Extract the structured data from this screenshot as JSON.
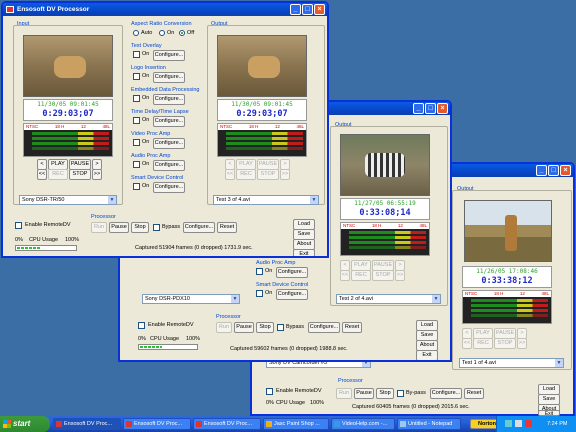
{
  "window1": {
    "title": "Ensosoft DV Processor",
    "input_label": "Input",
    "output_label": "Output",
    "in_date": "11/30/05 09:01:45",
    "in_time": "0:29:03;07",
    "out_date": "11/30/05 09:01:45",
    "out_time": "0:29:03;07",
    "meter_labels": [
      "NTSC",
      "18 H",
      "12",
      "48L"
    ],
    "aspect_label": "Aspect Ratio Conversion",
    "aspect_options": [
      "Auto",
      "On",
      "Off"
    ],
    "text_overlay": "Text Overlay",
    "logo_insertion": "Logo Insertion",
    "embedded": "Embedded Data Processing",
    "time_delay": "Time Delay/Time Lapse",
    "video_proc": "Video Proc Amp",
    "audio_proc": "Audio Proc Amp",
    "smart_device": "Smart Device Control",
    "on": "On",
    "configure": "Configure...",
    "play": "PLAY",
    "pause": "PAUSE",
    "rec": "REC",
    "stop": "STOP",
    "rew": "<<",
    "ffw": ">>",
    "prev": "<",
    "next": ">",
    "input_device": "Sony DSR-TR/50",
    "output_file": "Test 3 of 4.avi",
    "enable_remote": "Enable RemoteDV",
    "processor": "Processor",
    "run": "Run",
    "pause_btn": "Pause",
    "stop_btn": "Stop",
    "bypass": "Bypass",
    "reset": "Reset",
    "cpu_min": "0%",
    "cpu_label": "CPU Usage",
    "cpu_max": "100%",
    "captured": "Captured 51904 frames (0 dropped) 1731.9 sec.",
    "load": "Load",
    "save": "Save",
    "about": "About",
    "exit": "Exit"
  },
  "window2": {
    "output_label": "Output",
    "out_date": "11/27/05 06:55:19",
    "out_time": "0:33:08;14",
    "input_device": "Sony DSR-PDX10",
    "output_file": "Test 2 of 4.avi",
    "audio_proc": "Audio Proc Amp",
    "smart_device": "Smart Device Control",
    "captured": "Captured 59602 frames (0 dropped) 1988.8 sec."
  },
  "window3": {
    "output_label": "Output",
    "out_date": "11/26/05 17:08:46",
    "out_time": "0:33:38;12",
    "input_device": "Sony DV Camcorder #3",
    "output_file": "Test 1 of 4.avi",
    "bypass": "By-pass",
    "captured": "Captured 60405 frames (0 dropped) 2015.6 sec."
  },
  "taskbar": {
    "start": "start",
    "items": [
      "Ensosoft DV Proc...",
      "Ensosoft DV Proc...",
      "Ensosoft DV Proc...",
      "Jasc Paint Shop ...",
      "VideoHelp.com -...",
      "Untitled - Notepad"
    ],
    "norton": "Norton",
    "clock": "7:24 PM"
  },
  "colors": {
    "titlebar": "#0a5ae4",
    "desktop": "#3a6ea5",
    "timecode": "#1d27c9",
    "date": "#2aa02a"
  }
}
